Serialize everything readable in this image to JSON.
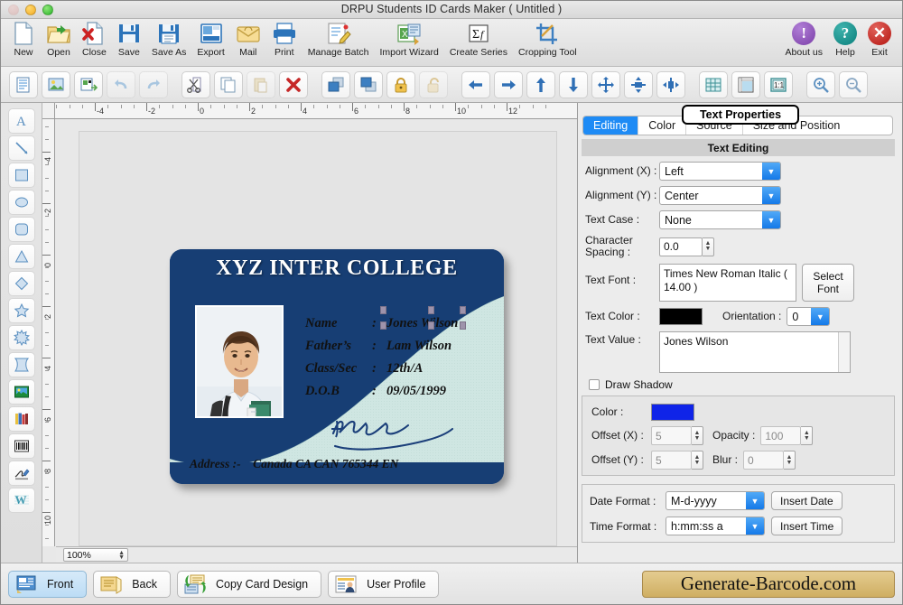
{
  "window": {
    "title": "DRPU Students ID Cards Maker ( Untitled )",
    "controls": [
      "close",
      "minimize",
      "zoom"
    ]
  },
  "toolbar": {
    "items": [
      {
        "label": "New",
        "icon": "new-document-icon"
      },
      {
        "label": "Open",
        "icon": "open-folder-icon"
      },
      {
        "label": "Close",
        "icon": "close-document-icon"
      },
      {
        "label": "Save",
        "icon": "save-icon"
      },
      {
        "label": "Save As",
        "icon": "save-as-icon"
      },
      {
        "label": "Export",
        "icon": "export-icon"
      },
      {
        "label": "Mail",
        "icon": "mail-icon"
      },
      {
        "label": "Print",
        "icon": "printer-icon"
      },
      {
        "label": "Manage Batch",
        "icon": "manage-batch-icon"
      },
      {
        "label": "Import Wizard",
        "icon": "import-wizard-icon"
      },
      {
        "label": "Create Series",
        "icon": "create-series-icon"
      },
      {
        "label": "Cropping Tool",
        "icon": "cropping-tool-icon"
      }
    ],
    "right_items": [
      {
        "label": "About us",
        "icon": "info-circle-icon",
        "color": "#7b3fa8"
      },
      {
        "label": "Help",
        "icon": "question-circle-icon",
        "color": "#0a7f7b"
      },
      {
        "label": "Exit",
        "icon": "close-circle-icon",
        "color": "#b3140f"
      }
    ]
  },
  "toolbar2": {
    "buttons": [
      {
        "name": "add-text-object-icon",
        "disabled": false
      },
      {
        "name": "add-image-object-icon",
        "disabled": false
      },
      {
        "name": "insert-object-icon",
        "disabled": false
      },
      {
        "name": "undo-icon",
        "disabled": true
      },
      {
        "name": "redo-icon",
        "disabled": true
      },
      {
        "name": "cut-icon",
        "disabled": false
      },
      {
        "name": "copy-icon",
        "disabled": false
      },
      {
        "name": "paste-icon",
        "disabled": true
      },
      {
        "name": "delete-icon",
        "disabled": false
      },
      {
        "name": "bring-to-front-icon",
        "disabled": false
      },
      {
        "name": "send-to-back-icon",
        "disabled": false
      },
      {
        "name": "lock-icon",
        "disabled": false
      },
      {
        "name": "unlock-icon",
        "disabled": true
      },
      {
        "name": "align-left-icon",
        "disabled": false
      },
      {
        "name": "align-right-icon",
        "disabled": false
      },
      {
        "name": "align-top-icon",
        "disabled": false
      },
      {
        "name": "align-bottom-icon",
        "disabled": false
      },
      {
        "name": "center-both-icon",
        "disabled": false
      },
      {
        "name": "center-horizontal-icon",
        "disabled": false
      },
      {
        "name": "center-vertical-icon",
        "disabled": false
      },
      {
        "name": "grid-icon",
        "disabled": false
      },
      {
        "name": "ruler-icon",
        "disabled": false
      },
      {
        "name": "actual-size-icon",
        "disabled": false,
        "label": "1:1"
      },
      {
        "name": "zoom-in-icon",
        "disabled": false
      },
      {
        "name": "zoom-out-icon",
        "disabled": false
      }
    ]
  },
  "palette": {
    "tools": [
      {
        "name": "text-tool-icon",
        "label": "A"
      },
      {
        "name": "line-tool-icon"
      },
      {
        "name": "rectangle-tool-icon"
      },
      {
        "name": "ellipse-tool-icon"
      },
      {
        "name": "rounded-rectangle-tool-icon"
      },
      {
        "name": "triangle-tool-icon"
      },
      {
        "name": "diamond-tool-icon"
      },
      {
        "name": "star-tool-icon"
      },
      {
        "name": "starburst-tool-icon"
      },
      {
        "name": "four-point-star-tool-icon"
      },
      {
        "name": "image-tool-icon"
      },
      {
        "name": "barcode-books-tool-icon"
      },
      {
        "name": "barcode-tool-icon"
      },
      {
        "name": "signature-tool-icon"
      },
      {
        "name": "watermark-tool-icon",
        "label": "W"
      }
    ]
  },
  "canvas": {
    "ruler_h_labels": [
      "-4",
      "-2",
      "0",
      "2",
      "4",
      "6",
      "8",
      "10",
      "12"
    ],
    "ruler_v_labels": [
      "-4",
      "-2",
      "0",
      "2",
      "4",
      "6",
      "8",
      "10"
    ],
    "zoom_level": "100%"
  },
  "card": {
    "title": "XYZ INTER COLLEGE",
    "fields": [
      {
        "label": "Name",
        "colon": ":",
        "value": "Jones Wilson",
        "selected": true
      },
      {
        "label": "Father’s",
        "colon": ":",
        "value": "Lam Wilson",
        "selected": false
      },
      {
        "label": "Class/Sec",
        "colon": ":",
        "value": "12th/A",
        "selected": false
      },
      {
        "label": "D.O.B",
        "colon": ":",
        "value": "09/05/1999",
        "selected": false
      }
    ],
    "address_label": "Address :-",
    "address_value": "Canada CA CAN 765344 EN",
    "colors": {
      "border": "#173e74",
      "body": "#cfe6e2",
      "text": "#111111",
      "title": "#ffffff",
      "signature": "#1b3f7a"
    }
  },
  "properties": {
    "panel_title": "Text Properties",
    "tabs": [
      {
        "label": "Editing",
        "active": true
      },
      {
        "label": "Color",
        "active": false
      },
      {
        "label": "Source",
        "active": false
      },
      {
        "label": "Size and Position",
        "active": false
      }
    ],
    "section_header": "Text Editing",
    "alignment_x": {
      "label": "Alignment (X) :",
      "value": "Left"
    },
    "alignment_y": {
      "label": "Alignment (Y) :",
      "value": "Center"
    },
    "text_case": {
      "label": "Text Case :",
      "value": "None"
    },
    "character_spacing": {
      "label": "Character Spacing :",
      "value": "0.0"
    },
    "text_font": {
      "label": "Text Font :",
      "value": "Times New Roman Italic ( 14.00 )",
      "button": "Select Font"
    },
    "text_color": {
      "label": "Text Color :",
      "value": "#000000"
    },
    "orientation": {
      "label": "Orientation :",
      "value": "0"
    },
    "text_value": {
      "label": "Text Value :",
      "value": "Jones Wilson"
    },
    "draw_shadow": {
      "label": "Draw Shadow",
      "checked": false
    },
    "shadow": {
      "color_label": "Color :",
      "color_value": "#0f24e8",
      "offset_x_label": "Offset (X) :",
      "offset_x": "5",
      "offset_y_label": "Offset (Y) :",
      "offset_y": "5",
      "opacity_label": "Opacity :",
      "opacity": "100",
      "blur_label": "Blur :",
      "blur": "0"
    },
    "date_format": {
      "label": "Date Format :",
      "value": "M-d-yyyy",
      "button": "Insert Date"
    },
    "time_format": {
      "label": "Time Format :",
      "value": "h:mm:ss a",
      "button": "Insert Time"
    }
  },
  "footer": {
    "buttons": [
      {
        "label": "Front",
        "icon": "card-front-icon",
        "active": true
      },
      {
        "label": "Back",
        "icon": "card-back-icon",
        "active": false
      },
      {
        "label": "Copy Card Design",
        "icon": "copy-design-icon",
        "active": false
      },
      {
        "label": "User Profile",
        "icon": "user-profile-icon",
        "active": false
      }
    ],
    "brand": "Generate-Barcode.com"
  }
}
